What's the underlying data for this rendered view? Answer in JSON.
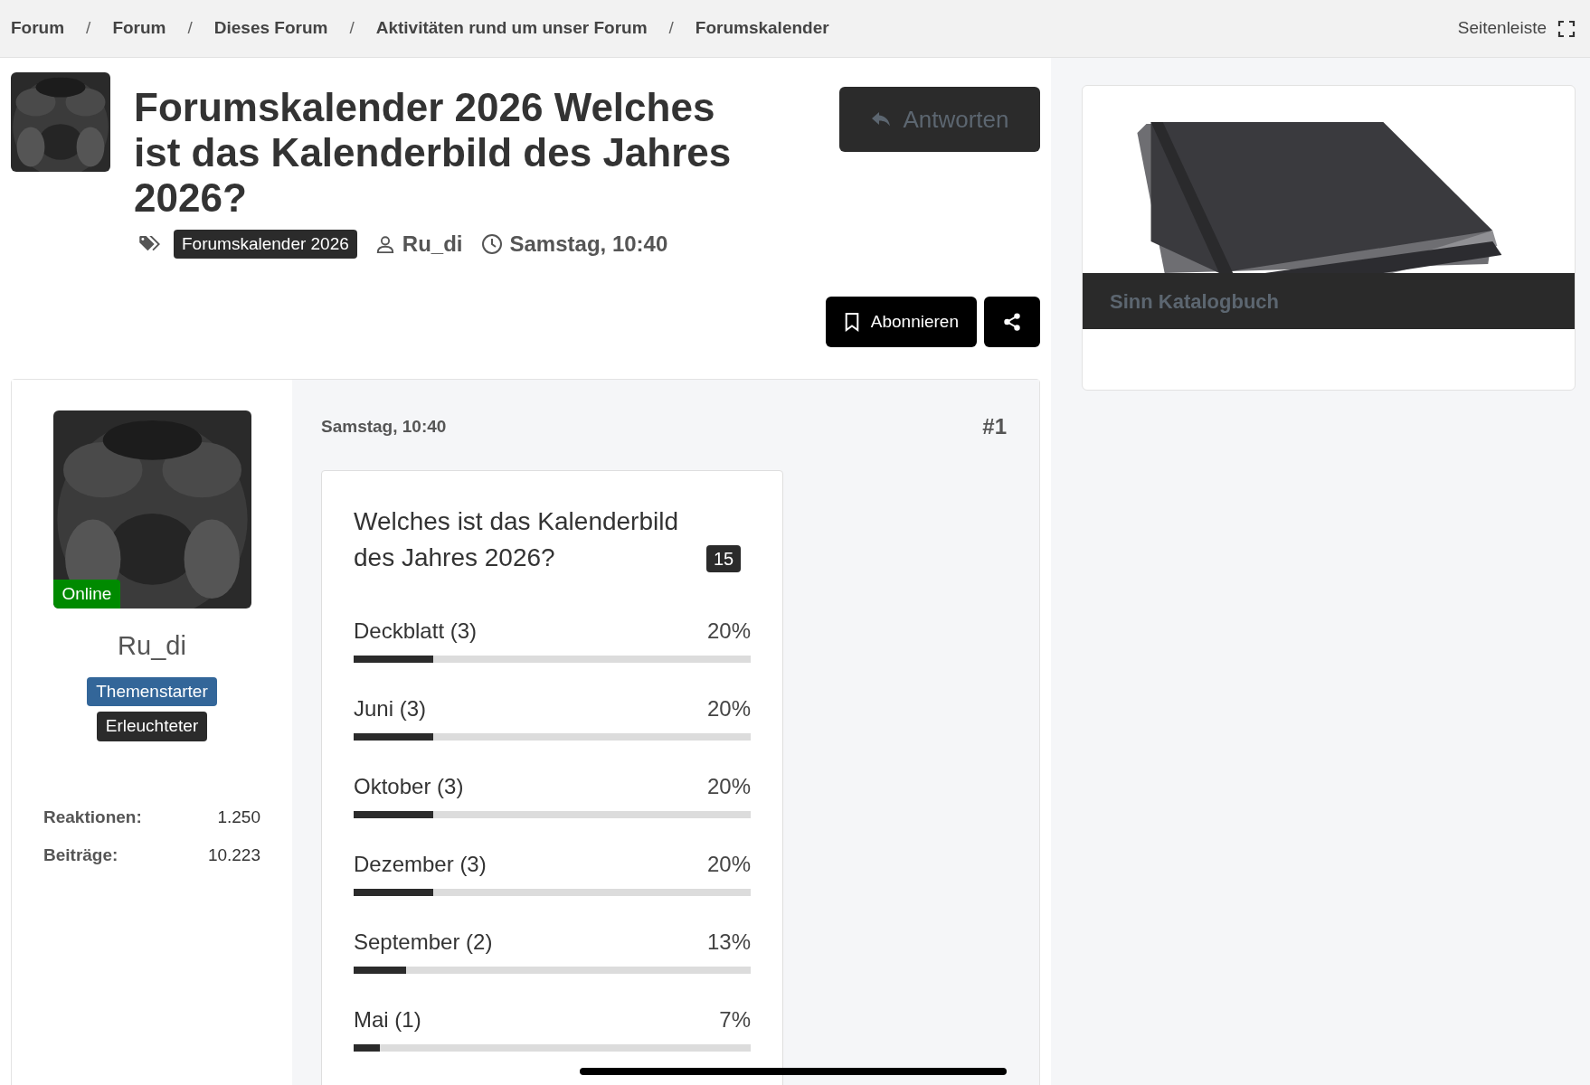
{
  "breadcrumbs": [
    {
      "label": "Forum"
    },
    {
      "label": "Forum"
    },
    {
      "label": "Dieses Forum"
    },
    {
      "label": "Aktivitäten rund um unser Forum"
    },
    {
      "label": "Forumskalender"
    }
  ],
  "breadcrumb_separator": "/",
  "sidebar_toggle": {
    "label": "Seitenleiste"
  },
  "thread": {
    "title": "Forumskalender 2026 Welches ist das Kalenderbild des Jahres 2026?",
    "tag": "Forumskalender 2026",
    "author": "Ru_di",
    "date": "Samstag, 10:40",
    "reply_button": {
      "label": "Antworten",
      "disabled": true
    },
    "subscribe_button": {
      "label": "Abonnieren"
    }
  },
  "post": {
    "user": {
      "name": "Ru_di",
      "online": true,
      "online_label": "Online",
      "badges": [
        {
          "label": "Themenstarter",
          "color": "#336699"
        },
        {
          "label": "Erleuchteter",
          "color": "#2b2b2b"
        }
      ],
      "stats": [
        {
          "label": "Reaktionen:",
          "value": "1.250"
        },
        {
          "label": "Beiträge:",
          "value": "10.223"
        }
      ]
    },
    "date": "Samstag, 10:40",
    "number": "#1",
    "poll": {
      "question": "Welches ist das Kalenderbild des Jahres 2026?",
      "votes": "15",
      "options": [
        {
          "label": "Deckblatt (3)",
          "percent": "20%",
          "level": 0.2
        },
        {
          "label": "Juni (3)",
          "percent": "20%",
          "level": 0.2
        },
        {
          "label": "Oktober (3)",
          "percent": "20%",
          "level": 0.2
        },
        {
          "label": "Dezember (3)",
          "percent": "20%",
          "level": 0.2
        },
        {
          "label": "September (2)",
          "percent": "13%",
          "level": 0.133
        },
        {
          "label": "Mai (1)",
          "percent": "7%",
          "level": 0.067
        }
      ]
    }
  },
  "sidebar": {
    "ad": {
      "kind": "picture",
      "caption": "Sinn Katalogbuch"
    }
  }
}
